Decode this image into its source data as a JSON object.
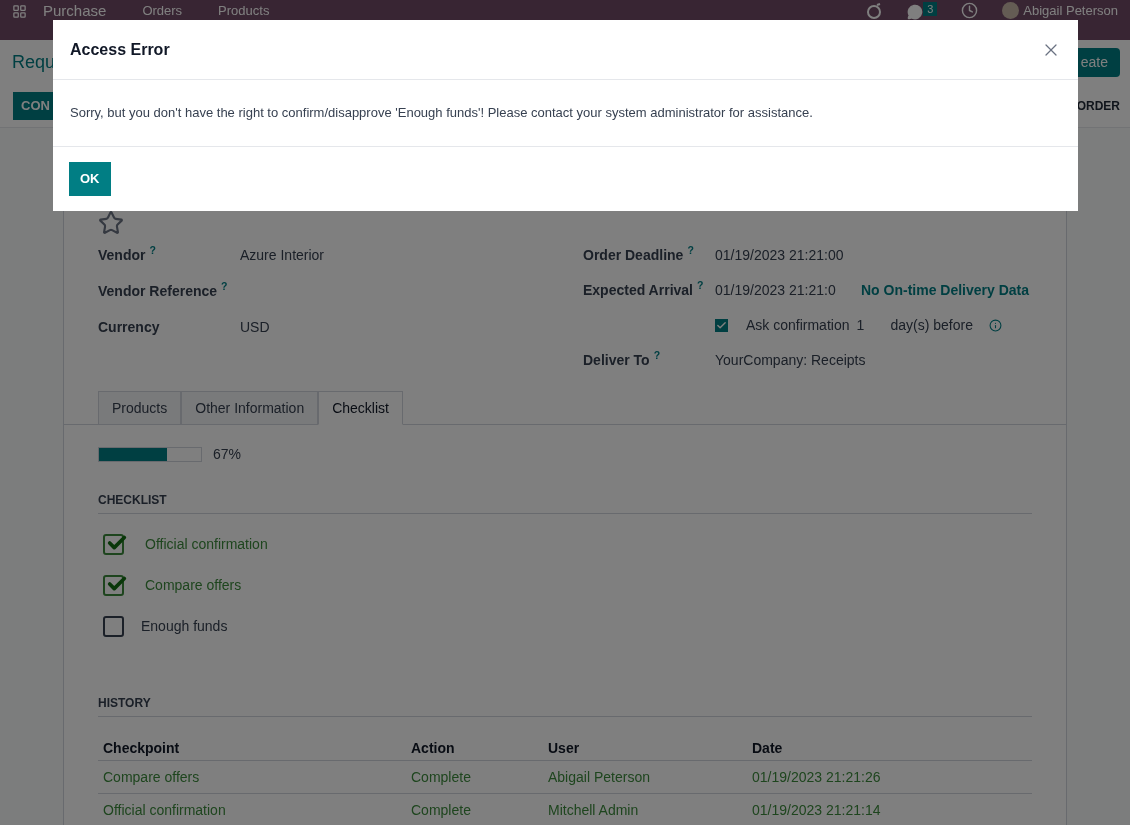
{
  "navbar": {
    "app_name": "Purchase",
    "menu": [
      "Orders",
      "Products"
    ],
    "chat_count": "3",
    "user": "Abigail Peterson"
  },
  "control_panel": {
    "title": "Requ",
    "create_button": "eate",
    "left_button": "CON",
    "right_button": "ORDER"
  },
  "form": {
    "left_fields": [
      {
        "label": "Vendor",
        "help": "?",
        "value": "Azure Interior"
      },
      {
        "label": "Vendor Reference",
        "help": "?"
      },
      {
        "label": "Currency",
        "value": "USD"
      }
    ],
    "right_fields": [
      {
        "kind": "text",
        "label": "Order Deadline",
        "help": "?",
        "value": "01/19/2023 21:21:00"
      },
      {
        "kind": "text",
        "label": "Expected Arrival",
        "help": "?",
        "value": "01/19/2023 21:21:0",
        "link": "No On-time Delivery Data"
      },
      {
        "kind": "checkbox",
        "label": "Ask confirmation",
        "checked": true,
        "value": "1",
        "suffix": "day(s) before"
      },
      {
        "kind": "text",
        "label": "Deliver To",
        "help": "?",
        "value": "YourCompany: Receipts"
      }
    ],
    "tabs": [
      {
        "label": "Products",
        "selected": false
      },
      {
        "label": "Other Information",
        "selected": false
      },
      {
        "label": "Checklist",
        "selected": true
      }
    ],
    "progress": {
      "level": 0.67,
      "text": "67%"
    },
    "checklist_title": "CHECKLIST",
    "checklist": [
      {
        "label": "Official confirmation",
        "checked": true
      },
      {
        "label": "Compare offers",
        "checked": true
      },
      {
        "label": "Enough funds",
        "checked": false
      }
    ],
    "history_title": "HISTORY",
    "history": {
      "columns": [
        "Checkpoint",
        "Action",
        "User",
        "Date"
      ],
      "rows": [
        [
          "Compare offers",
          "Complete",
          "Abigail Peterson",
          "01/19/2023 21:21:26"
        ],
        [
          "Official confirmation",
          "Complete",
          "Mitchell Admin",
          "01/19/2023 21:21:14"
        ]
      ]
    }
  },
  "dialog": {
    "title": "Access Error",
    "message": "Sorry, but you don't have the right to confirm/disapprove 'Enough funds'! Please contact your system administrator for assistance.",
    "ok": "OK"
  }
}
